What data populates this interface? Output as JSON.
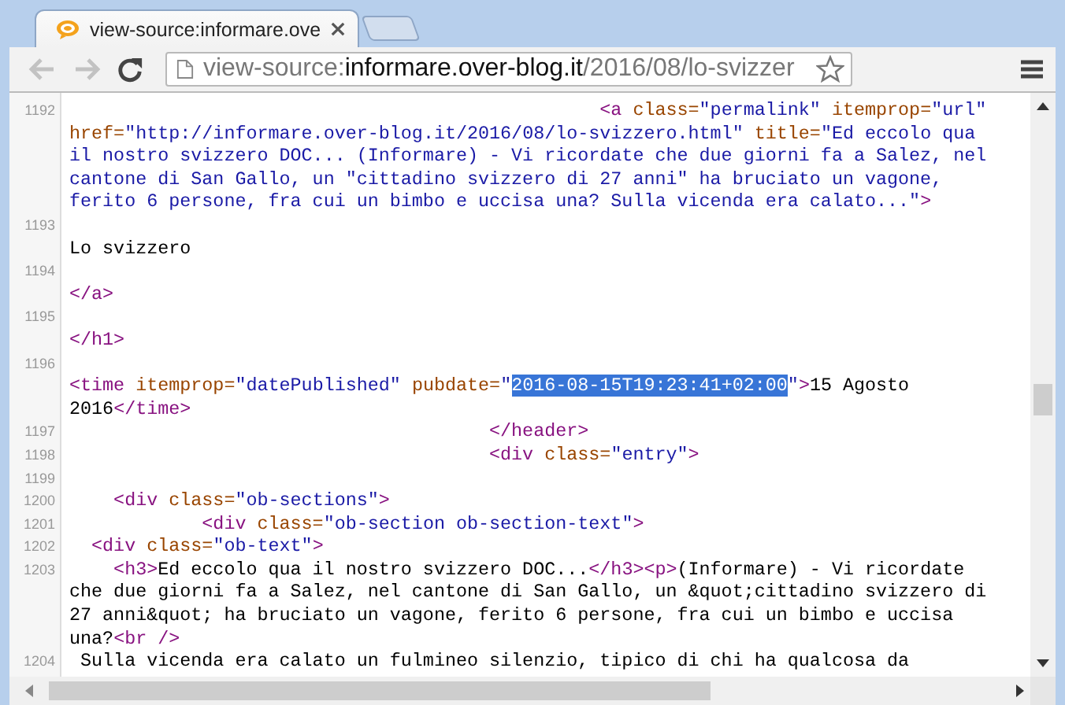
{
  "tab": {
    "title": "view-source:informare.ove"
  },
  "toolbar": {
    "back_disabled": true,
    "forward_disabled": true
  },
  "address_bar": {
    "scheme": "view-source:",
    "host": "informare.over-blog.it",
    "path": "/2016/08/lo-svizzer"
  },
  "source_lines": [
    {
      "number": "1192",
      "wrapped": [
        [
          {
            "kind": "tag",
            "text": "                                                <a"
          },
          {
            "kind": "attr",
            "text": " class="
          },
          {
            "kind": "value",
            "text": "\"permalink\""
          },
          {
            "kind": "attr",
            "text": " itemprop="
          },
          {
            "kind": "value",
            "text": "\"url\""
          }
        ],
        [
          {
            "kind": "attr",
            "text": "href="
          },
          {
            "kind": "value",
            "text": "\"http://informare.over-blog.it/2016/08/lo-svizzero.html\""
          },
          {
            "kind": "attr",
            "text": " title="
          },
          {
            "kind": "value",
            "text": "\"Ed eccolo qua"
          }
        ],
        [
          {
            "kind": "value",
            "text": "il nostro svizzero DOC... (Informare) - Vi ricordate che due giorni fa a Salez, nel"
          }
        ],
        [
          {
            "kind": "value",
            "text": "cantone di San Gallo, un \"cittadino svizzero di 27 anni\" ha bruciato un vagone,"
          }
        ],
        [
          {
            "kind": "value",
            "text": "ferito 6 persone, fra cui un bimbo e uccisa una? Sulla vicenda era calato...\""
          },
          {
            "kind": "tag",
            "text": ">"
          }
        ]
      ]
    },
    {
      "number": "1193",
      "wrapped": [
        [
          {
            "kind": "text",
            "text": "\nLo svizzero"
          }
        ]
      ]
    },
    {
      "number": "1194",
      "wrapped": [
        [
          {
            "kind": "tag",
            "text": "\n</a>"
          }
        ]
      ]
    },
    {
      "number": "1195",
      "wrapped": [
        [
          {
            "kind": "tag",
            "text": "\n</h1>"
          }
        ]
      ]
    },
    {
      "number": "1196",
      "wrapped": [
        [
          {
            "kind": "tag",
            "text": "\n<time"
          },
          {
            "kind": "attr",
            "text": " itemprop="
          },
          {
            "kind": "value",
            "text": "\"datePublished\""
          },
          {
            "kind": "attr",
            "text": " pubdate="
          },
          {
            "kind": "value",
            "text": "\""
          },
          {
            "kind": "selected",
            "text": "2016-08-15T19:23:41+02:00"
          },
          {
            "kind": "value",
            "text": "\""
          },
          {
            "kind": "tag",
            "text": ">"
          },
          {
            "kind": "text",
            "text": "15 Agosto"
          }
        ],
        [
          {
            "kind": "text",
            "text": "2016"
          },
          {
            "kind": "tag",
            "text": "</time>"
          }
        ]
      ]
    },
    {
      "number": "1197",
      "wrapped": [
        [
          {
            "kind": "tag",
            "text": "                                      </header>"
          }
        ]
      ]
    },
    {
      "number": "1198",
      "wrapped": [
        [
          {
            "kind": "tag",
            "text": "                                      <div"
          },
          {
            "kind": "attr",
            "text": " class="
          },
          {
            "kind": "value",
            "text": "\"entry\""
          },
          {
            "kind": "tag",
            "text": ">"
          }
        ]
      ]
    },
    {
      "number": "1199"
    },
    {
      "number": "1200",
      "wrapped": [
        [
          {
            "kind": "tag",
            "text": "    <div"
          },
          {
            "kind": "attr",
            "text": " class="
          },
          {
            "kind": "value",
            "text": "\"ob-sections\""
          },
          {
            "kind": "tag",
            "text": ">"
          }
        ]
      ]
    },
    {
      "number": "1201",
      "wrapped": [
        [
          {
            "kind": "tag",
            "text": "            <div"
          },
          {
            "kind": "attr",
            "text": " class="
          },
          {
            "kind": "value",
            "text": "\"ob-section ob-section-text\""
          },
          {
            "kind": "tag",
            "text": ">"
          }
        ]
      ]
    },
    {
      "number": "1202",
      "wrapped": [
        [
          {
            "kind": "tag",
            "text": "  <div"
          },
          {
            "kind": "attr",
            "text": " class="
          },
          {
            "kind": "value",
            "text": "\"ob-text\""
          },
          {
            "kind": "tag",
            "text": ">"
          }
        ]
      ]
    },
    {
      "number": "1203",
      "wrapped": [
        [
          {
            "kind": "tag",
            "text": "    <h3>"
          },
          {
            "kind": "text",
            "text": "Ed eccolo qua il nostro svizzero DOC..."
          },
          {
            "kind": "tag",
            "text": "</h3><p>"
          },
          {
            "kind": "text",
            "text": "(Informare) - Vi ricordate"
          }
        ],
        [
          {
            "kind": "text",
            "text": "che due giorni fa a Salez, nel cantone di San Gallo, un &quot;cittadino svizzero di"
          }
        ],
        [
          {
            "kind": "text",
            "text": "27 anni&quot; ha bruciato un vagone, ferito 6 persone, fra cui un bimbo e uccisa"
          }
        ],
        [
          {
            "kind": "text",
            "text": "una?"
          },
          {
            "kind": "tag",
            "text": "<br />"
          }
        ]
      ]
    },
    {
      "number": "1204",
      "wrapped": [
        [
          {
            "kind": "text",
            "text": " Sulla vicenda era calato un fulmineo silenzio, tipico di chi ha qualcosa da"
          }
        ]
      ]
    }
  ]
}
